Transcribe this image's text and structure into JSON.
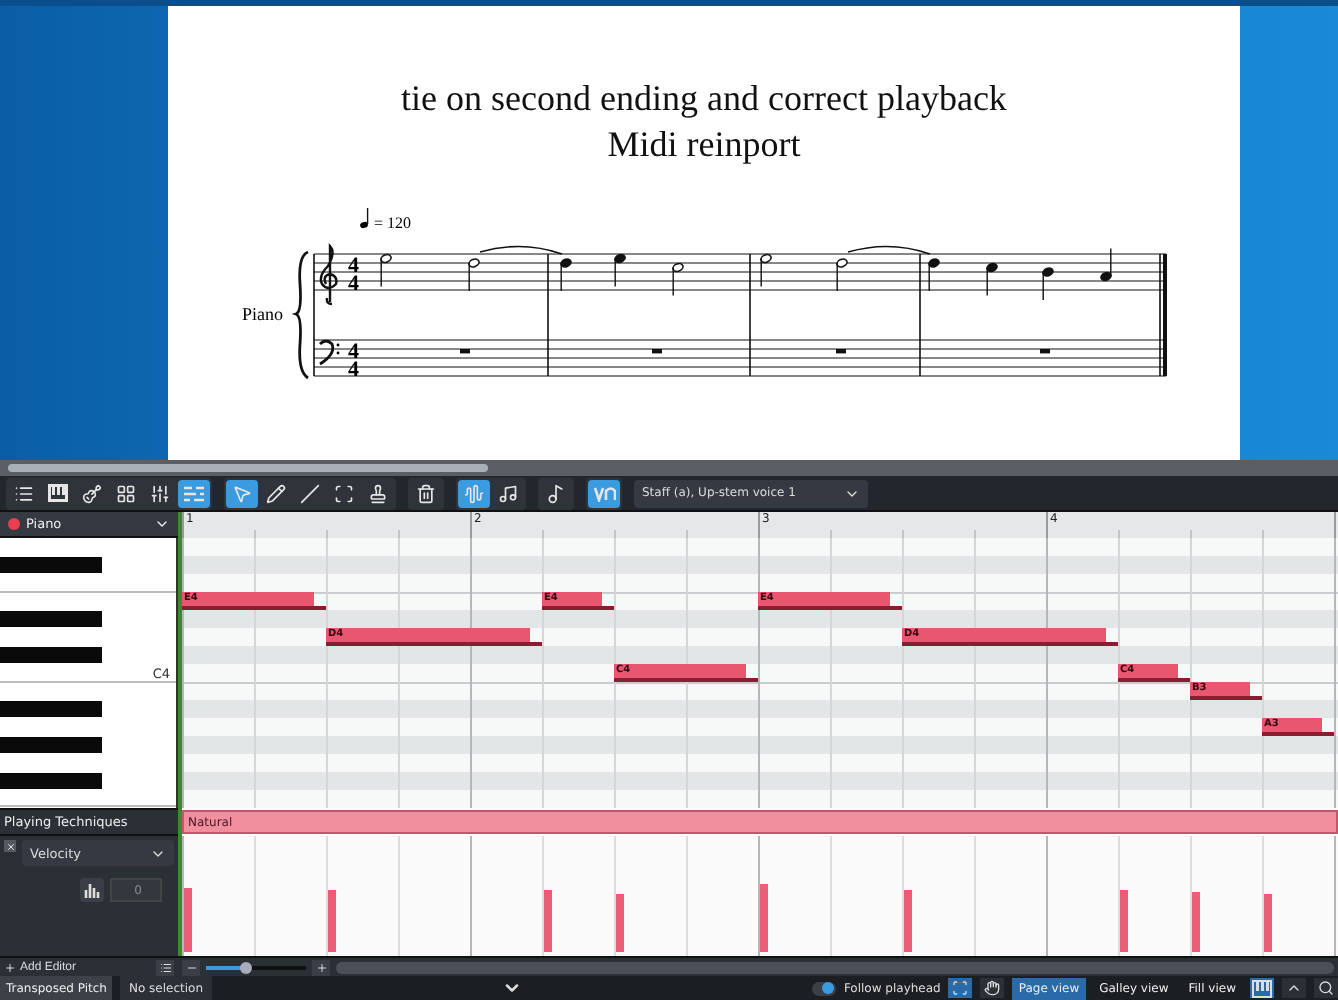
{
  "score": {
    "title": "tie on second ending and correct playback",
    "subtitle": "Midi reinport",
    "tempo": "= 120",
    "instrument": "Piano",
    "staves": [
      {
        "kind": "treble",
        "numerator": "4",
        "denominator": "4"
      },
      {
        "kind": "bass",
        "numerator": "4",
        "denominator": "4"
      }
    ]
  },
  "toolbar": {
    "groups": [
      {
        "tools": [
          {
            "selected": false
          },
          {
            "selected": false
          },
          {
            "selected": false
          },
          {
            "selected": false
          },
          {
            "selected": false
          },
          {
            "selected": true
          }
        ]
      },
      {
        "tools": [
          {
            "selected": true
          },
          {
            "selected": false
          },
          {
            "selected": false
          },
          {
            "selected": false
          },
          {
            "selected": false
          }
        ]
      },
      {
        "tools": [
          {
            "selected": false
          }
        ]
      },
      {
        "tools": [
          {
            "selected": true
          },
          {
            "selected": false
          }
        ]
      },
      {
        "tools": [
          {
            "selected": false
          }
        ]
      },
      {
        "tools": [
          {
            "selected": true
          }
        ]
      }
    ],
    "voice_select": "Staff (a), Up-stem voice 1"
  },
  "key_editor": {
    "instrument": "Piano",
    "key_label": "C4",
    "bars": [
      "1",
      "2",
      "3",
      "4"
    ],
    "notes": [
      {
        "label": "E4"
      },
      {
        "label": "D4"
      },
      {
        "label": "E4"
      },
      {
        "label": "C4"
      },
      {
        "label": "E4"
      },
      {
        "label": "D4"
      },
      {
        "label": "C4"
      },
      {
        "label": "B3"
      },
      {
        "label": "A3"
      }
    ],
    "playing_techniques_label": "Playing Techniques",
    "technique": "Natural",
    "lane": {
      "property": "Velocity",
      "value": "0"
    },
    "add_editor": "Add Editor",
    "zoom": {
      "level": 0.4
    }
  },
  "status_bar": {
    "pitch_mode": "Transposed Pitch",
    "selection": "No selection",
    "follow_playhead": {
      "label": "Follow playhead",
      "on": true
    },
    "views": [
      {
        "label": "Page view",
        "selected": true
      },
      {
        "label": "Galley view",
        "selected": false
      },
      {
        "label": "Fill view",
        "selected": false
      }
    ]
  }
}
